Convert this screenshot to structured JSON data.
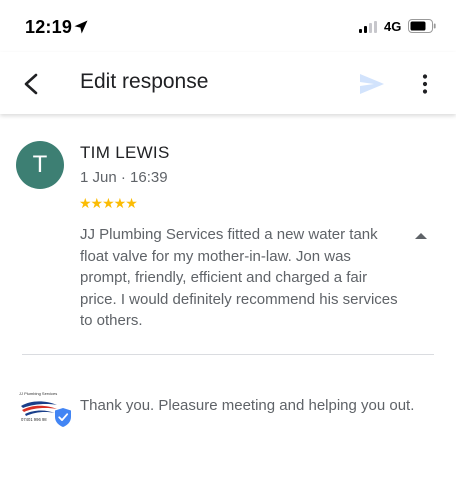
{
  "status_bar": {
    "time": "12:19",
    "network": "4G",
    "icons": [
      "location-arrow-icon",
      "signal-icon",
      "battery-icon"
    ]
  },
  "app_bar": {
    "title": "Edit response",
    "icons": [
      "back-arrow-icon",
      "send-icon",
      "more-vert-icon"
    ]
  },
  "review": {
    "avatar_letter": "T",
    "reviewer_name": "TIM LEWIS",
    "time": "1 Jun · 16:39",
    "stars": "★★★★★",
    "rating": 5,
    "text": "JJ Plumbing Services fitted a new water tank float valve for my mother-in-law. Jon was prompt, friendly, efficient and charged a fair price. I would definitely recommend his services to others."
  },
  "reply": {
    "logo_caption": "JJ Plumbing Services",
    "logo_phone": "07401 996 98",
    "text": "Thank you. Pleasure meeting and helping you out."
  },
  "colors": {
    "avatar": "#3d7f73",
    "stars": "#fbbc04",
    "send_disabled": "#d2e3fc",
    "verified": "#4285f4"
  }
}
